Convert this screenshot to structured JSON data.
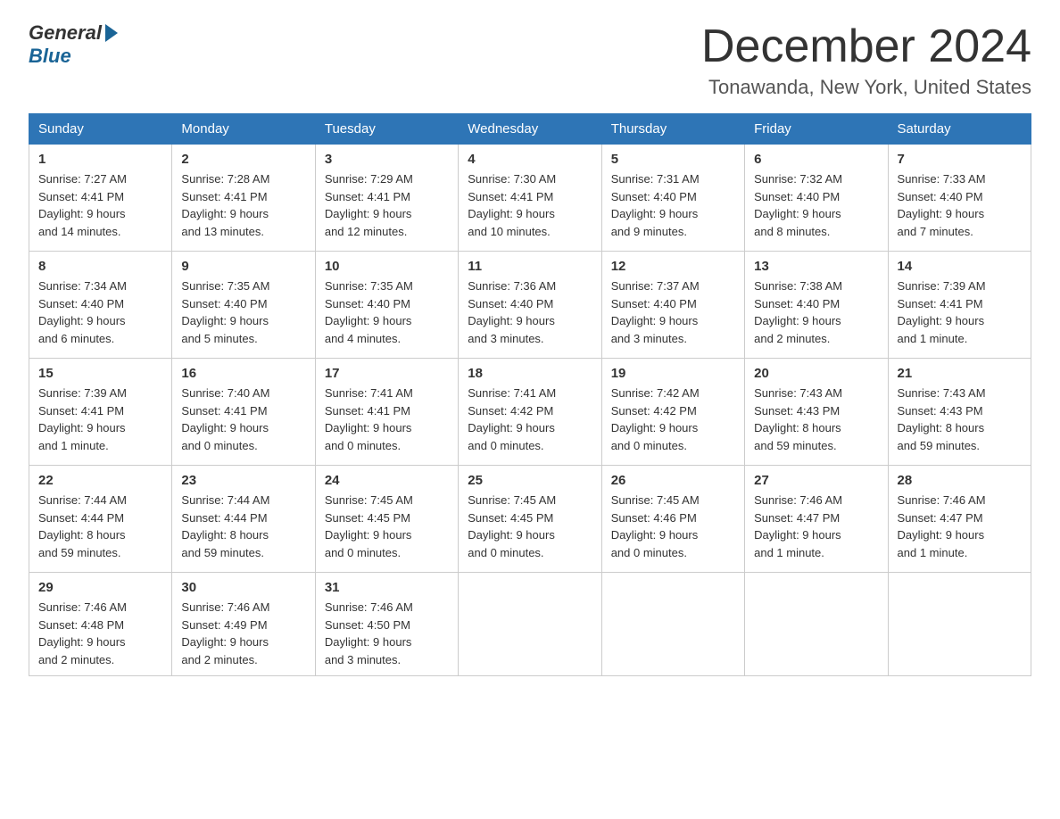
{
  "logo": {
    "general": "General",
    "blue": "Blue"
  },
  "title": {
    "month": "December 2024",
    "location": "Tonawanda, New York, United States"
  },
  "headers": [
    "Sunday",
    "Monday",
    "Tuesday",
    "Wednesday",
    "Thursday",
    "Friday",
    "Saturday"
  ],
  "weeks": [
    [
      {
        "day": "1",
        "info": "Sunrise: 7:27 AM\nSunset: 4:41 PM\nDaylight: 9 hours\nand 14 minutes."
      },
      {
        "day": "2",
        "info": "Sunrise: 7:28 AM\nSunset: 4:41 PM\nDaylight: 9 hours\nand 13 minutes."
      },
      {
        "day": "3",
        "info": "Sunrise: 7:29 AM\nSunset: 4:41 PM\nDaylight: 9 hours\nand 12 minutes."
      },
      {
        "day": "4",
        "info": "Sunrise: 7:30 AM\nSunset: 4:41 PM\nDaylight: 9 hours\nand 10 minutes."
      },
      {
        "day": "5",
        "info": "Sunrise: 7:31 AM\nSunset: 4:40 PM\nDaylight: 9 hours\nand 9 minutes."
      },
      {
        "day": "6",
        "info": "Sunrise: 7:32 AM\nSunset: 4:40 PM\nDaylight: 9 hours\nand 8 minutes."
      },
      {
        "day": "7",
        "info": "Sunrise: 7:33 AM\nSunset: 4:40 PM\nDaylight: 9 hours\nand 7 minutes."
      }
    ],
    [
      {
        "day": "8",
        "info": "Sunrise: 7:34 AM\nSunset: 4:40 PM\nDaylight: 9 hours\nand 6 minutes."
      },
      {
        "day": "9",
        "info": "Sunrise: 7:35 AM\nSunset: 4:40 PM\nDaylight: 9 hours\nand 5 minutes."
      },
      {
        "day": "10",
        "info": "Sunrise: 7:35 AM\nSunset: 4:40 PM\nDaylight: 9 hours\nand 4 minutes."
      },
      {
        "day": "11",
        "info": "Sunrise: 7:36 AM\nSunset: 4:40 PM\nDaylight: 9 hours\nand 3 minutes."
      },
      {
        "day": "12",
        "info": "Sunrise: 7:37 AM\nSunset: 4:40 PM\nDaylight: 9 hours\nand 3 minutes."
      },
      {
        "day": "13",
        "info": "Sunrise: 7:38 AM\nSunset: 4:40 PM\nDaylight: 9 hours\nand 2 minutes."
      },
      {
        "day": "14",
        "info": "Sunrise: 7:39 AM\nSunset: 4:41 PM\nDaylight: 9 hours\nand 1 minute."
      }
    ],
    [
      {
        "day": "15",
        "info": "Sunrise: 7:39 AM\nSunset: 4:41 PM\nDaylight: 9 hours\nand 1 minute."
      },
      {
        "day": "16",
        "info": "Sunrise: 7:40 AM\nSunset: 4:41 PM\nDaylight: 9 hours\nand 0 minutes."
      },
      {
        "day": "17",
        "info": "Sunrise: 7:41 AM\nSunset: 4:41 PM\nDaylight: 9 hours\nand 0 minutes."
      },
      {
        "day": "18",
        "info": "Sunrise: 7:41 AM\nSunset: 4:42 PM\nDaylight: 9 hours\nand 0 minutes."
      },
      {
        "day": "19",
        "info": "Sunrise: 7:42 AM\nSunset: 4:42 PM\nDaylight: 9 hours\nand 0 minutes."
      },
      {
        "day": "20",
        "info": "Sunrise: 7:43 AM\nSunset: 4:43 PM\nDaylight: 8 hours\nand 59 minutes."
      },
      {
        "day": "21",
        "info": "Sunrise: 7:43 AM\nSunset: 4:43 PM\nDaylight: 8 hours\nand 59 minutes."
      }
    ],
    [
      {
        "day": "22",
        "info": "Sunrise: 7:44 AM\nSunset: 4:44 PM\nDaylight: 8 hours\nand 59 minutes."
      },
      {
        "day": "23",
        "info": "Sunrise: 7:44 AM\nSunset: 4:44 PM\nDaylight: 8 hours\nand 59 minutes."
      },
      {
        "day": "24",
        "info": "Sunrise: 7:45 AM\nSunset: 4:45 PM\nDaylight: 9 hours\nand 0 minutes."
      },
      {
        "day": "25",
        "info": "Sunrise: 7:45 AM\nSunset: 4:45 PM\nDaylight: 9 hours\nand 0 minutes."
      },
      {
        "day": "26",
        "info": "Sunrise: 7:45 AM\nSunset: 4:46 PM\nDaylight: 9 hours\nand 0 minutes."
      },
      {
        "day": "27",
        "info": "Sunrise: 7:46 AM\nSunset: 4:47 PM\nDaylight: 9 hours\nand 1 minute."
      },
      {
        "day": "28",
        "info": "Sunrise: 7:46 AM\nSunset: 4:47 PM\nDaylight: 9 hours\nand 1 minute."
      }
    ],
    [
      {
        "day": "29",
        "info": "Sunrise: 7:46 AM\nSunset: 4:48 PM\nDaylight: 9 hours\nand 2 minutes."
      },
      {
        "day": "30",
        "info": "Sunrise: 7:46 AM\nSunset: 4:49 PM\nDaylight: 9 hours\nand 2 minutes."
      },
      {
        "day": "31",
        "info": "Sunrise: 7:46 AM\nSunset: 4:50 PM\nDaylight: 9 hours\nand 3 minutes."
      },
      {
        "day": "",
        "info": ""
      },
      {
        "day": "",
        "info": ""
      },
      {
        "day": "",
        "info": ""
      },
      {
        "day": "",
        "info": ""
      }
    ]
  ]
}
